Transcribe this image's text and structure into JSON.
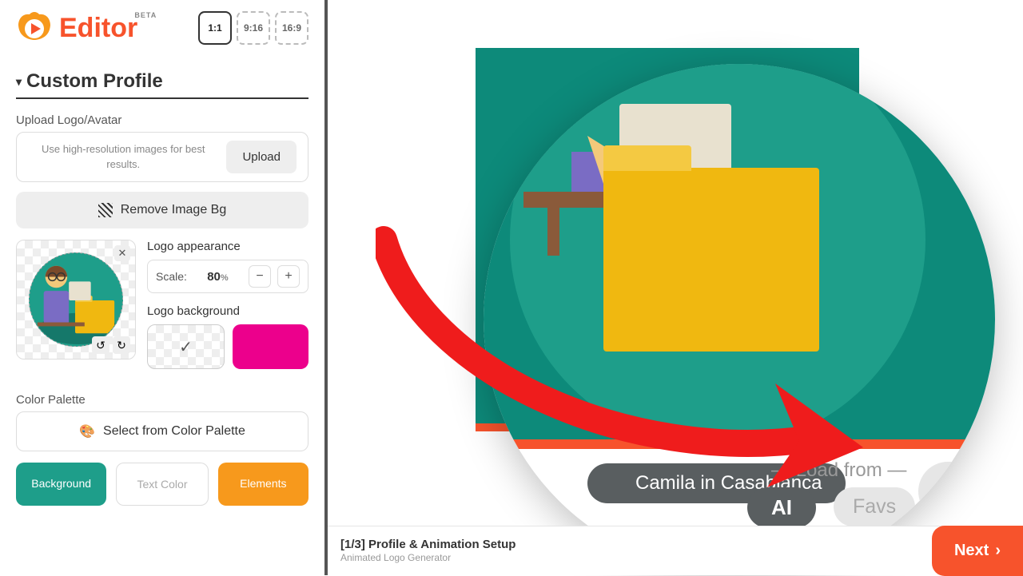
{
  "header": {
    "brand": "Editor",
    "badge": "BETA",
    "ratios": [
      "1:1",
      "9:16",
      "16:9"
    ]
  },
  "section": {
    "title": "Custom Profile"
  },
  "upload": {
    "label": "Upload Logo/Avatar",
    "hint": "Use high-resolution images for best results.",
    "button": "Upload"
  },
  "removeBg": "Remove Image Bg",
  "appearance": {
    "label": "Logo appearance",
    "scaleLabel": "Scale:",
    "scaleValue": "80",
    "pct": "%"
  },
  "logoBg": {
    "label": "Logo background"
  },
  "palette": {
    "title": "Color Palette",
    "select": "Select from Color Palette",
    "chips": {
      "bg": "Background",
      "text": "Text Color",
      "elem": "Elements"
    }
  },
  "magnifier": {
    "name": "Camila in Casablanca",
    "loadFrom": "Load from",
    "ai": "AI",
    "favs": "Favs"
  },
  "footer": {
    "step": "[1/3] Profile & Animation Setup",
    "sub": "Animated Logo Generator",
    "next": "Next"
  },
  "colors": {
    "teal": "#0d8a7a",
    "orange": "#f7532c",
    "pink": "#ec008c",
    "amber": "#f7991c"
  }
}
